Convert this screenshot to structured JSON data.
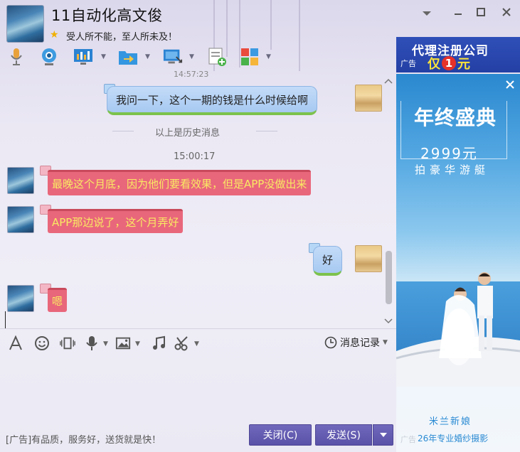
{
  "header": {
    "title": "11自动化高文俊",
    "signature": "受人所不能，至人所未及！"
  },
  "toolbar": {
    "icons": [
      "microphone-icon",
      "webcam-icon",
      "screen-share-icon",
      "folder-transfer-icon",
      "remote-desktop-icon",
      "note-add-icon",
      "apps-grid-icon"
    ]
  },
  "chat": {
    "top_partial_time": "14:57:23",
    "history_message": "我问一下，这个一期的钱是什么时候给啊",
    "history_divider": "以上是历史消息",
    "timestamp": "15:00:17",
    "messages": [
      {
        "from": "them",
        "text": "最晚这个月底，因为他们要看效果，但是APP没做出来"
      },
      {
        "from": "them",
        "text": "APP那边说了，这个月弄好"
      },
      {
        "from": "me",
        "text": "好"
      },
      {
        "from": "them",
        "text": "嗯"
      }
    ]
  },
  "input_toolbar": {
    "history_label": "消息记录"
  },
  "bottom": {
    "ad_text": "[广告]有品质，服务好，送货就是快！",
    "close_button": "关闭(C)",
    "send_button": "发送(S)"
  },
  "ads": {
    "top_banner": {
      "label": "广告",
      "headline": "代理注册公司",
      "sub_prefix": "仅",
      "sub_number": "1",
      "sub_suffix": "元"
    },
    "side_banner": {
      "title": "年终盛典",
      "price": "2999元",
      "line": "拍豪华游艇",
      "brand": "米兰新娘",
      "label": "广告",
      "footer": "26年专业婚纱摄影"
    }
  },
  "colors": {
    "them_bubble": "#e9677b",
    "them_text": "#f9ea63",
    "me_bubble": "#a7c9f1",
    "button": "#5a52a8"
  }
}
